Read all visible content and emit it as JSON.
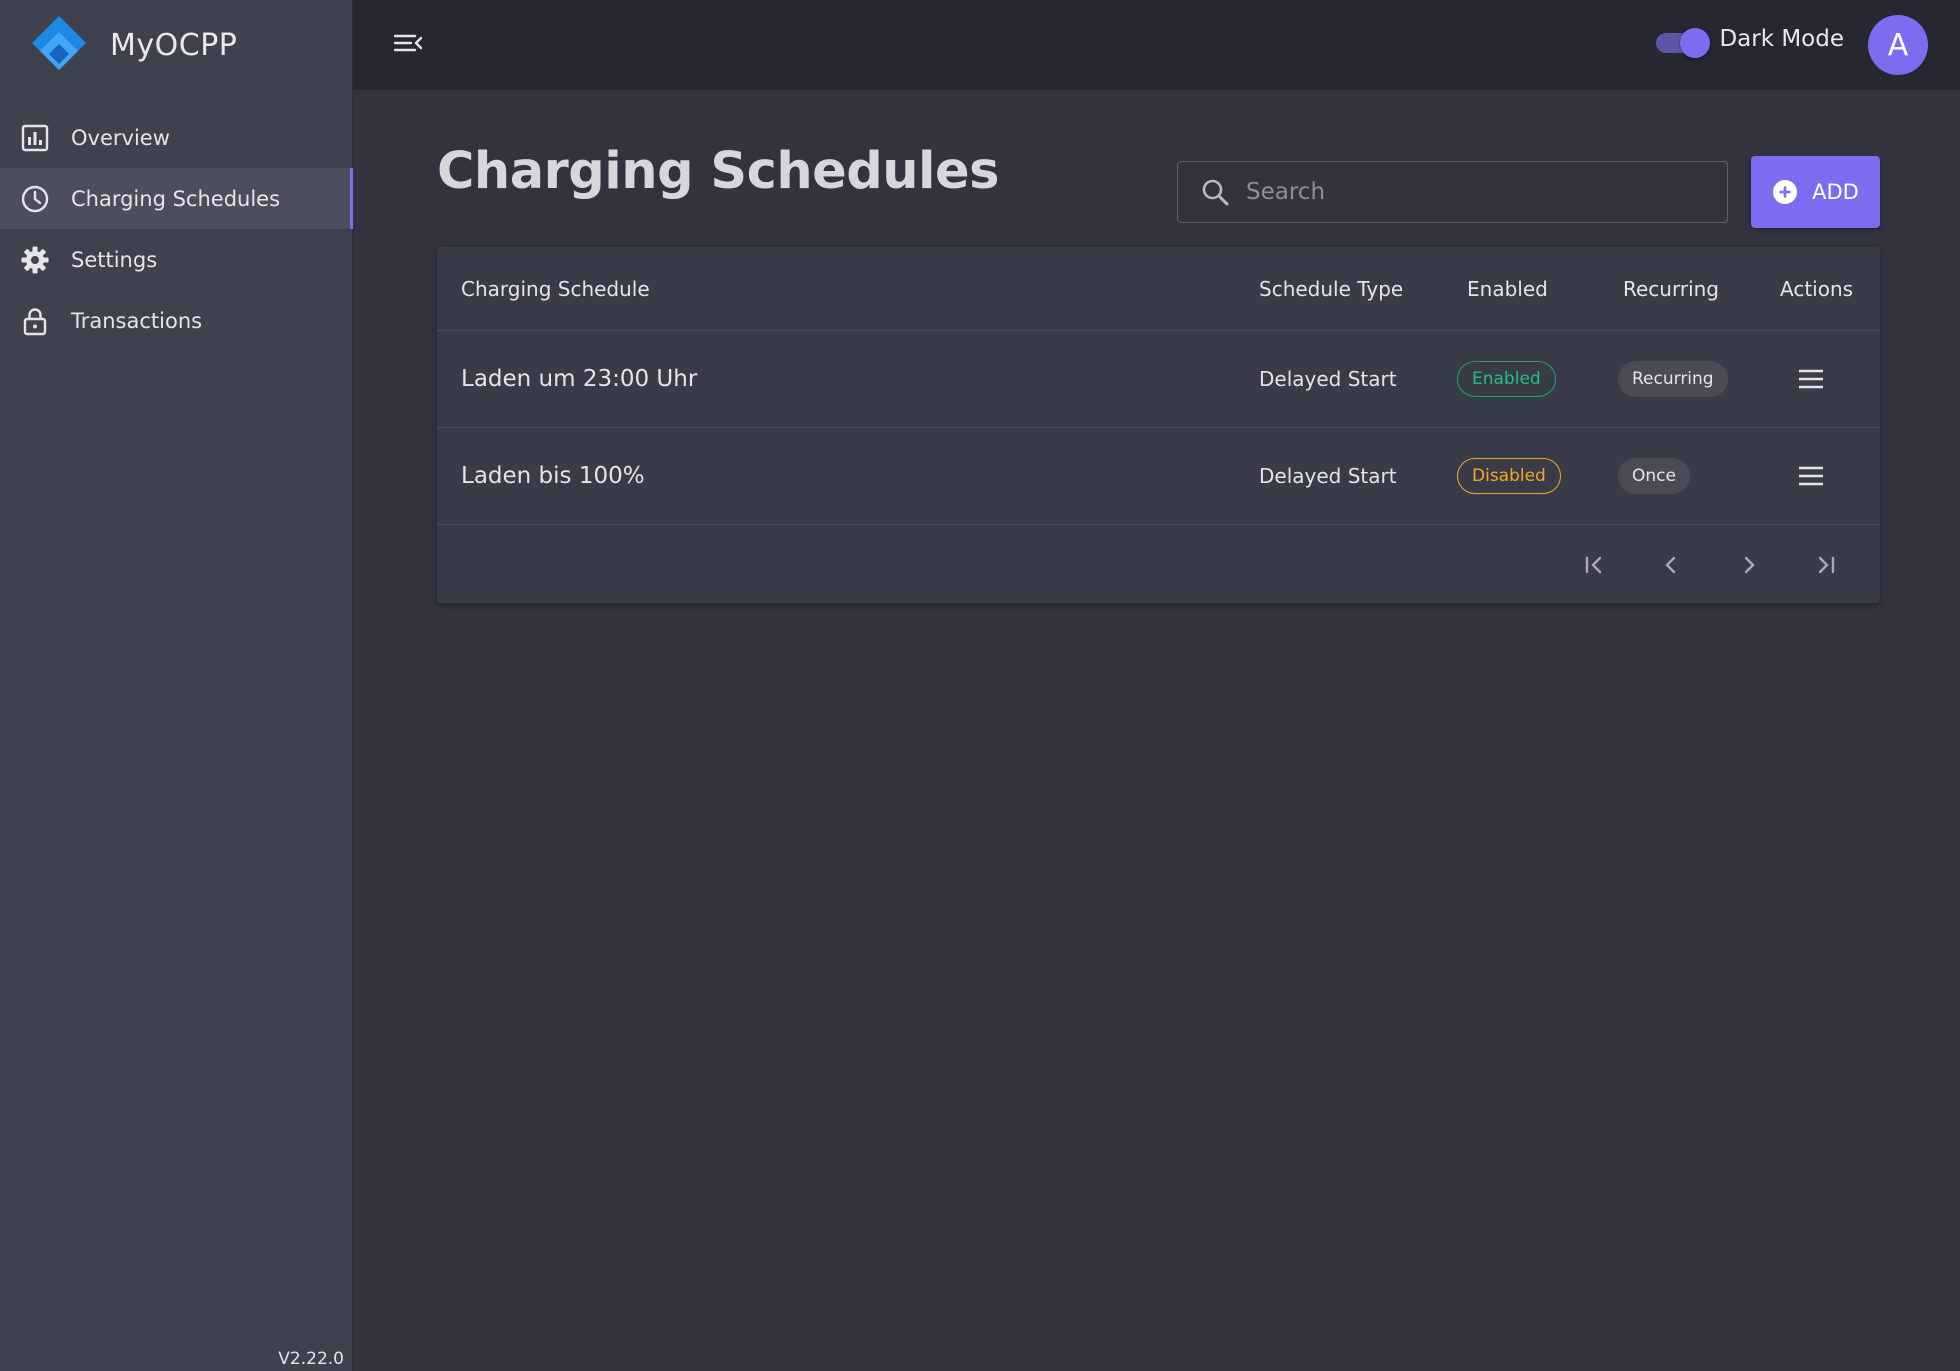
{
  "app": {
    "name": "MyOCPP",
    "version": "V2.22.0"
  },
  "sidebar": {
    "items": [
      {
        "label": "Overview",
        "icon": "chart-icon",
        "active": false
      },
      {
        "label": "Charging Schedules",
        "icon": "clock-icon",
        "active": true
      },
      {
        "label": "Settings",
        "icon": "gear-icon",
        "active": false
      },
      {
        "label": "Transactions",
        "icon": "lock-icon",
        "active": false
      }
    ]
  },
  "header": {
    "dark_mode_label": "Dark Mode",
    "dark_mode_on": true,
    "avatar_initial": "A"
  },
  "page": {
    "title": "Charging Schedules",
    "search_placeholder": "Search",
    "search_value": "",
    "add_label": "ADD"
  },
  "table": {
    "columns": {
      "name": "Charging Schedule",
      "type": "Schedule Type",
      "enabled": "Enabled",
      "recurring": "Recurring",
      "actions": "Actions"
    },
    "rows": [
      {
        "name": "Laden um 23:00 Uhr",
        "type": "Delayed Start",
        "enabled": "Enabled",
        "recurring": "Recurring"
      },
      {
        "name": "Laden bis 100%",
        "type": "Delayed Start",
        "enabled": "Disabled",
        "recurring": "Once"
      }
    ]
  },
  "colors": {
    "accent": "#7b6cf0",
    "enabled_chip": "#1cc285",
    "disabled_chip": "#f5a623",
    "sidebar_bg": "#40414e",
    "topbar_bg": "#262730",
    "content_bg": "#32333f"
  }
}
